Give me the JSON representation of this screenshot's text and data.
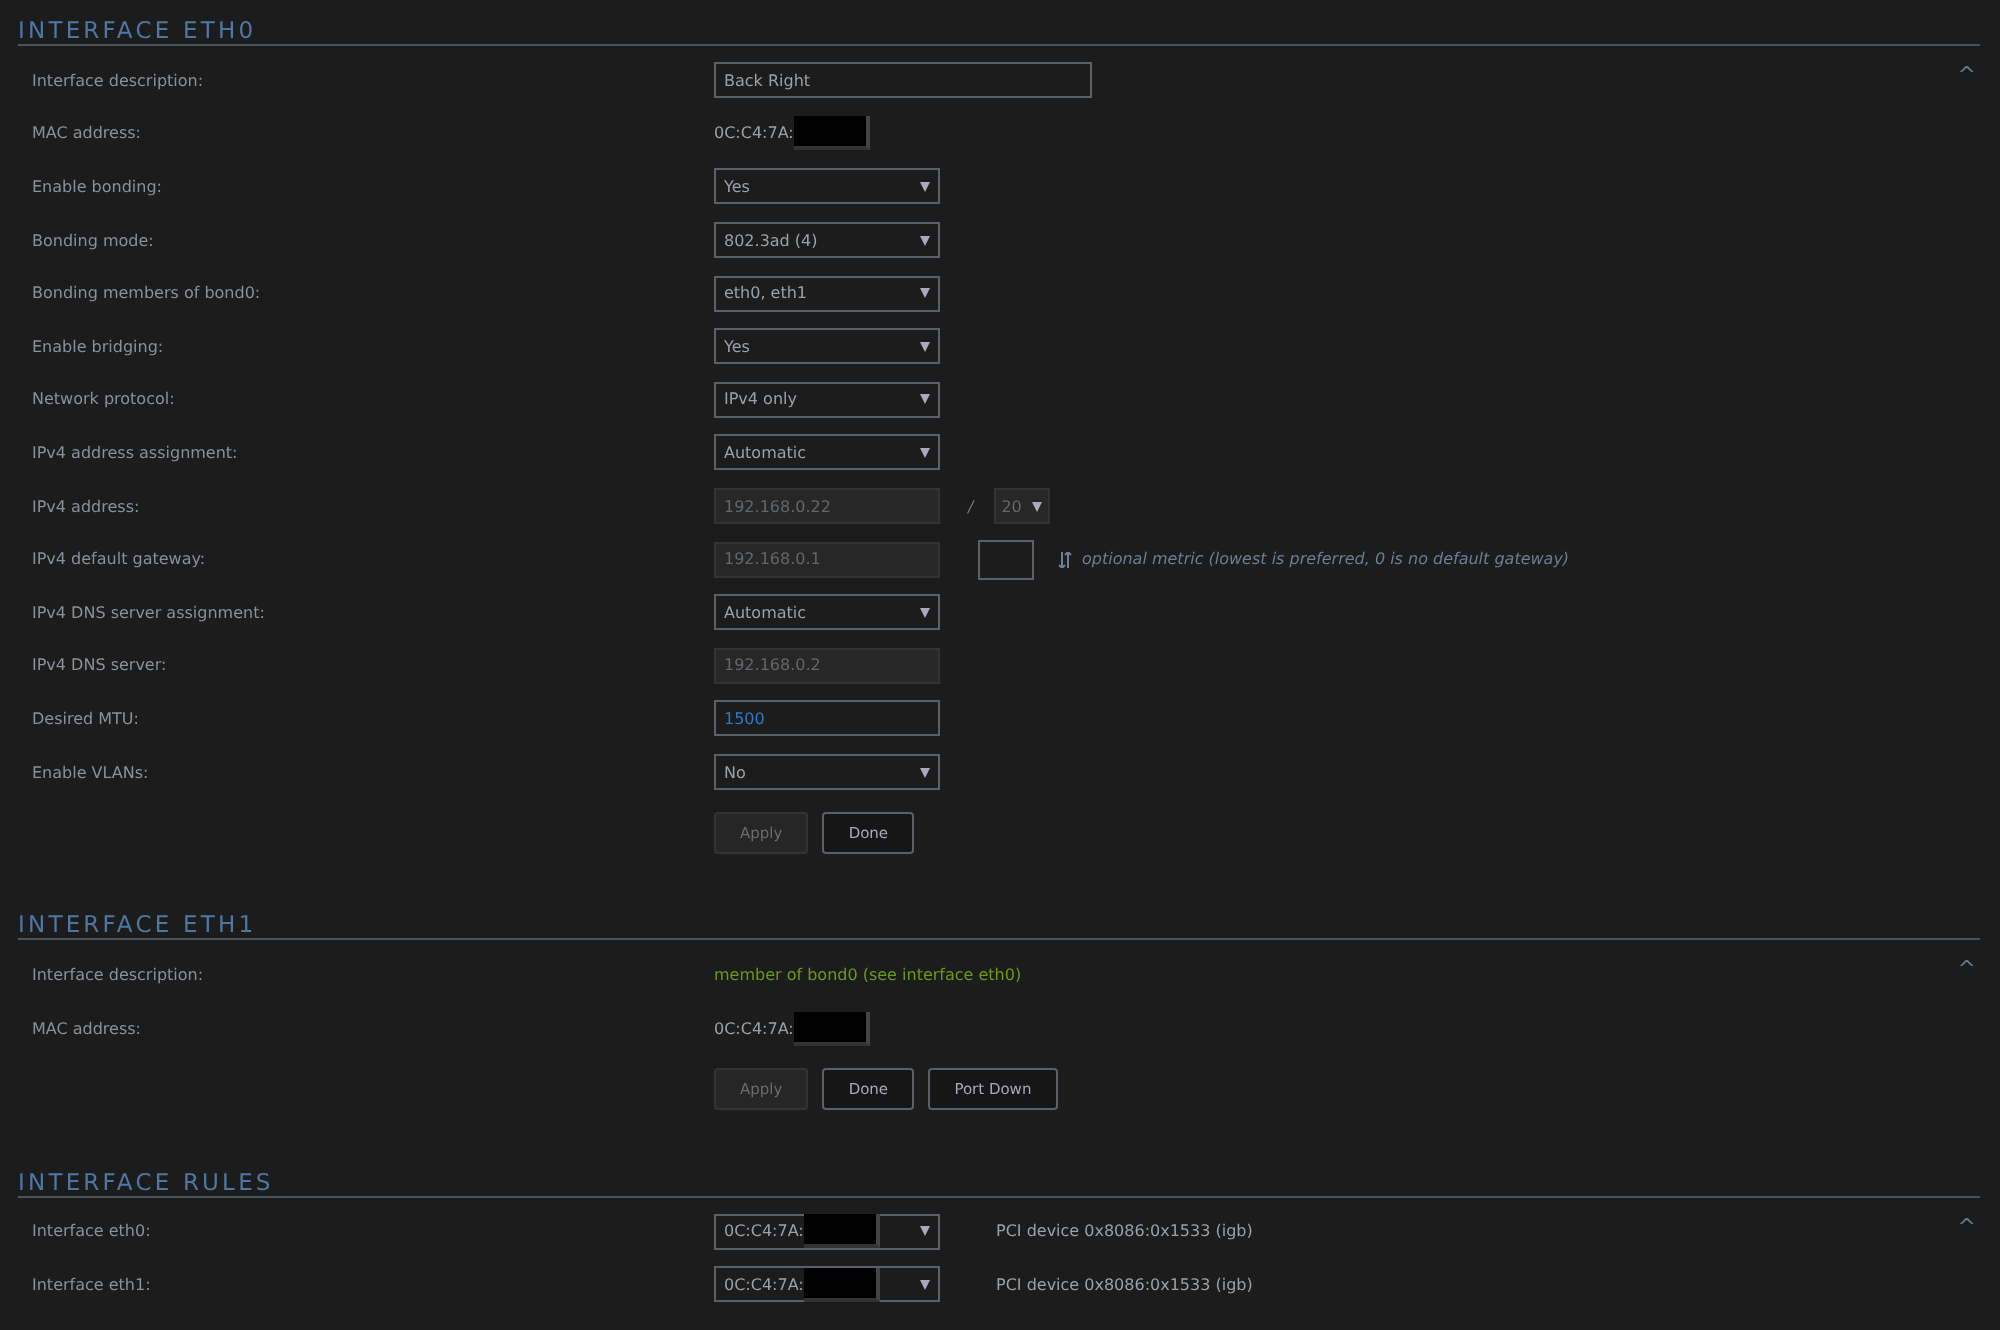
{
  "sections": [
    {
      "title": "INTERFACE ETH0",
      "collapse_icon": "^",
      "rows": [
        {
          "label": "Interface description:",
          "kind": "input",
          "value": "Back Right",
          "disabled": false,
          "changed": false,
          "wide": true
        },
        {
          "label": "MAC address:",
          "kind": "mac",
          "value": "0C:C4:7A:"
        },
        {
          "label": "Enable bonding:",
          "kind": "select",
          "value": "Yes",
          "disabled": false
        },
        {
          "label": "Bonding mode:",
          "kind": "select",
          "value": "802.3ad (4)",
          "disabled": false
        },
        {
          "label": "Bonding members of bond0:",
          "kind": "select",
          "value": "eth0, eth1",
          "disabled": false
        },
        {
          "label": "Enable bridging:",
          "kind": "select",
          "value": "Yes",
          "disabled": false
        },
        {
          "label": "Network protocol:",
          "kind": "select",
          "value": "IPv4 only",
          "disabled": false
        },
        {
          "label": "IPv4 address assignment:",
          "kind": "select",
          "value": "Automatic",
          "disabled": false
        },
        {
          "label": "IPv4 address:",
          "kind": "cidr",
          "value": "192.168.0.22",
          "disabled": true,
          "separator": "/",
          "prefix": "20"
        },
        {
          "label": "IPv4 default gateway:",
          "kind": "gateway",
          "value": "192.168.0.1",
          "disabled": true,
          "note": "optional metric (lowest is preferred, 0 is no default gateway)"
        },
        {
          "label": "IPv4 DNS server assignment:",
          "kind": "select",
          "value": "Automatic",
          "disabled": false
        },
        {
          "label": "IPv4 DNS server:",
          "kind": "input",
          "value": "192.168.0.2",
          "disabled": true,
          "changed": false,
          "wide": false
        },
        {
          "label": "Desired MTU:",
          "kind": "input",
          "value": "1500",
          "disabled": false,
          "changed": true,
          "wide": false
        },
        {
          "label": "Enable VLANs:",
          "kind": "select",
          "value": "No",
          "disabled": false
        }
      ],
      "buttons": [
        {
          "label": "Apply",
          "disabled": true
        },
        {
          "label": "Done",
          "disabled": false
        }
      ]
    },
    {
      "title": "INTERFACE ETH1",
      "collapse_icon": "^",
      "rows": [
        {
          "label": "Interface description:",
          "kind": "note",
          "value": "member of bond0 (see interface eth0)"
        },
        {
          "label": "MAC address:",
          "kind": "mac",
          "value": "0C:C4:7A:"
        }
      ],
      "buttons": [
        {
          "label": "Apply",
          "disabled": true
        },
        {
          "label": "Done",
          "disabled": false
        },
        {
          "label": "Port Down",
          "disabled": false
        }
      ]
    },
    {
      "title": "INTERFACE RULES",
      "collapse_icon": "^",
      "rows": [
        {
          "label": "Interface eth0:",
          "kind": "macselect",
          "value": "0C:C4:7A:",
          "info": "PCI device 0x8086:0x1533 (igb)"
        },
        {
          "label": "Interface eth1:",
          "kind": "macselect",
          "value": "0C:C4:7A:",
          "info": "PCI device 0x8086:0x1533 (igb)"
        }
      ]
    }
  ]
}
